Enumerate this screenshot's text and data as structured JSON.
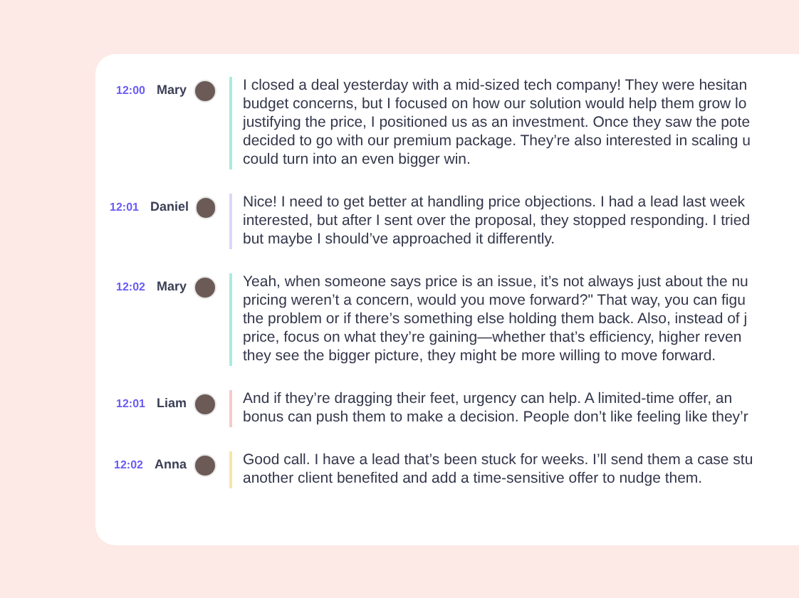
{
  "messages": [
    {
      "time": "12:00",
      "name": "Mary",
      "color": "#a7ecdc",
      "lines": [
        "I closed a deal yesterday with a mid-sized tech company! They were hesitan",
        "budget concerns, but I focused on how our solution would help them grow lo",
        "justifying the price, I positioned us as an investment. Once they saw the pote",
        "decided to go with our premium package. They’re also interested in scaling u",
        "could turn into an even bigger win."
      ]
    },
    {
      "time": "12:01",
      "name": "Daniel",
      "color": "#ddd6f8",
      "lines": [
        "Nice! I need to get better at handling price objections. I had a lead last week",
        "interested, but after I sent over the proposal, they stopped responding. I tried",
        "but maybe I should’ve approached it differently."
      ]
    },
    {
      "time": "12:02",
      "name": "Mary",
      "color": "#a7ecdc",
      "lines": [
        "Yeah, when someone says price is an issue, it’s not always just about the nu",
        "pricing weren’t a concern, would you move forward?\" That way, you can figu",
        "the problem or if there’s something else holding them back. Also, instead of j",
        "price, focus on what they’re gaining—whether that’s efficiency, higher reven",
        "they see the bigger picture, they might be more willing to move forward."
      ]
    },
    {
      "time": "12:01",
      "name": "Liam",
      "color": "#f7c9c9",
      "lines": [
        "And if they’re dragging their feet, urgency can help. A limited-time offer, an",
        "bonus can push them to make a decision. People don’t like feeling like they’r"
      ]
    },
    {
      "time": "12:02",
      "name": "Anna",
      "color": "#f6e6a8",
      "lines": [
        "Good call. I have a lead that’s been stuck for weeks. I’ll send them a case stu",
        "another client benefited and add a time-sensitive offer to nudge them."
      ]
    }
  ]
}
